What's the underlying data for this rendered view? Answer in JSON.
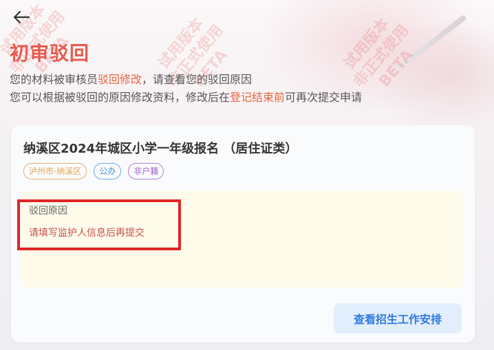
{
  "page": {
    "title": "初审驳回",
    "desc_line1": {
      "a": "您的材料被审核员",
      "highlight": "驳回修改",
      "b": "，请查看您的驳回原因"
    },
    "desc_line2": {
      "a": "您可以根据被驳回的原因修改资料，修改后在",
      "highlight": "登记结束前",
      "b": "可再次提交申请"
    }
  },
  "icons": {
    "back": "arrow-left-icon"
  },
  "card": {
    "title": "纳溪区2024年城区小学一年级报名 （居住证类）",
    "tags": [
      "泸州市-纳溪区",
      "公办",
      "非户籍"
    ],
    "reason_label": "驳回原因",
    "reason_text": "请填写监护人信息后再提交",
    "action_button": "查看招生工作安排"
  },
  "watermark": {
    "line1": "试用版本",
    "line2": "非正式使用",
    "line3": "BETA"
  },
  "colors": {
    "title": "#e85a4f",
    "highlight": "#e9653f",
    "reason_text": "#c85050",
    "button_text": "#2f7ae0",
    "button_bg": "#e2eefc",
    "annotation_box": "#e02424"
  }
}
